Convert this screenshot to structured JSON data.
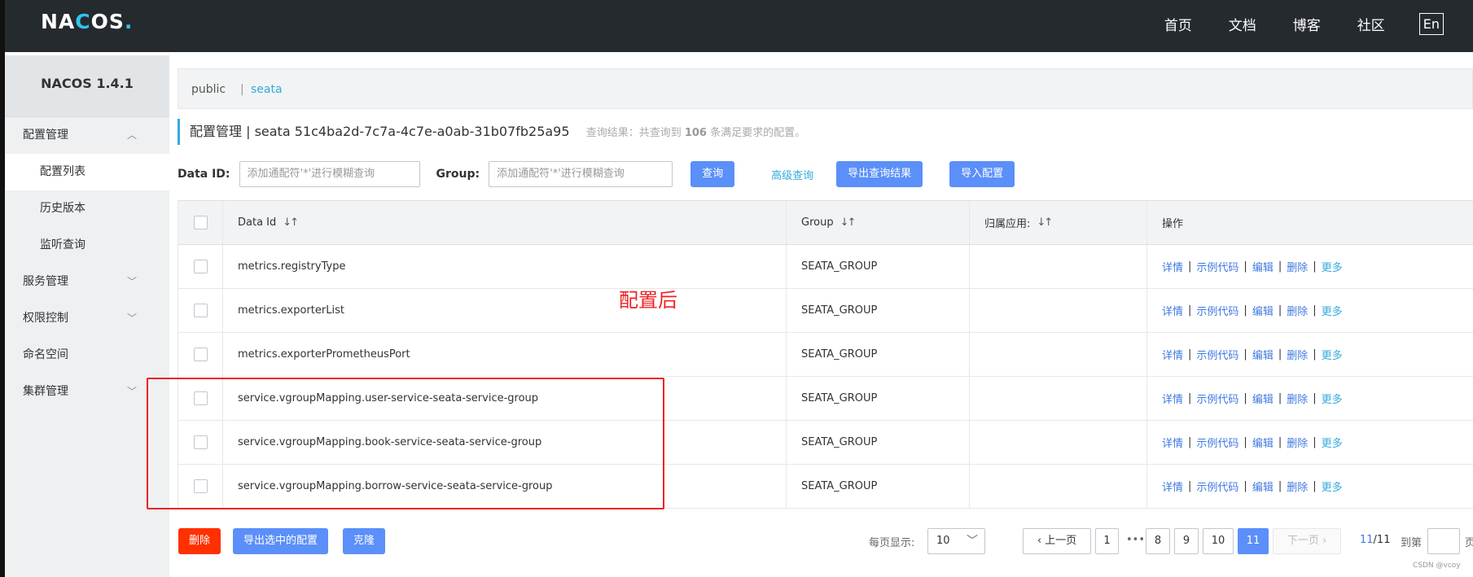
{
  "header": {
    "logo": "NACOS.",
    "nav": [
      "首页",
      "文档",
      "博客",
      "社区"
    ],
    "lang": "En"
  },
  "sidebar": {
    "version": "NACOS 1.4.1",
    "items": [
      {
        "label": "配置管理",
        "type": "group",
        "chevron": "up"
      },
      {
        "label": "配置列表",
        "type": "sub",
        "active": true
      },
      {
        "label": "历史版本",
        "type": "sub"
      },
      {
        "label": "监听查询",
        "type": "sub"
      },
      {
        "label": "服务管理",
        "type": "group",
        "chevron": "down"
      },
      {
        "label": "权限控制",
        "type": "group",
        "chevron": "down"
      },
      {
        "label": "命名空间",
        "type": "group"
      },
      {
        "label": "集群管理",
        "type": "group",
        "chevron": "down"
      }
    ]
  },
  "namespaces": {
    "public": "public",
    "sep": "|",
    "seata": "seata"
  },
  "title": {
    "text": "配置管理  |  seata  51c4ba2d-7c7a-4c7e-a0ab-31b07fb25a95",
    "hint_prefix": "查询结果：共查询到",
    "hint_count": "106",
    "hint_suffix": "条满足要求的配置。"
  },
  "search": {
    "dataid_label": "Data ID:",
    "dataid_placeholder": "添加通配符'*'进行模糊查询",
    "group_label": "Group:",
    "group_placeholder": "添加通配符'*'进行模糊查询",
    "query_btn": "查询",
    "advanced_link": "高级查询",
    "export_btn": "导出查询结果",
    "import_btn": "导入配置"
  },
  "table": {
    "headers": {
      "dataid": "Data Id",
      "group": "Group",
      "app": "归属应用:",
      "ops": "操作"
    },
    "ops": {
      "detail": "详情",
      "sample": "示例代码",
      "edit": "编辑",
      "delete": "删除",
      "more": "更多",
      "sep": "|"
    },
    "rows": [
      {
        "dataid": "metrics.registryType",
        "group": "SEATA_GROUP",
        "app": ""
      },
      {
        "dataid": "metrics.exporterList",
        "group": "SEATA_GROUP",
        "app": ""
      },
      {
        "dataid": "metrics.exporterPrometheusPort",
        "group": "SEATA_GROUP",
        "app": ""
      },
      {
        "dataid": "service.vgroupMapping.user-service-seata-service-group",
        "group": "SEATA_GROUP",
        "app": ""
      },
      {
        "dataid": "service.vgroupMapping.book-service-seata-service-group",
        "group": "SEATA_GROUP",
        "app": ""
      },
      {
        "dataid": "service.vgroupMapping.borrow-service-seata-service-group",
        "group": "SEATA_GROUP",
        "app": ""
      }
    ]
  },
  "annotation": {
    "text": "配置后",
    "color": "#ee2222"
  },
  "footer": {
    "delete_btn": "删除",
    "export_selected_btn": "导出选中的配置",
    "clone_btn": "克隆",
    "per_page_label": "每页显示:",
    "per_page_value": "10",
    "prev": "上一页",
    "next": "下一页",
    "pages": [
      "1",
      "8",
      "9",
      "10",
      "11"
    ],
    "ellipsis": "•••",
    "current_page": "11",
    "total": "/11",
    "goto_label": "到第",
    "goto_suffix": "页"
  },
  "watermark": "CSDN @vcoy",
  "colors": {
    "primary": "#5b8ff9",
    "danger": "#ff3000",
    "link": "#33aadd",
    "header_bg": "#252a2f"
  }
}
